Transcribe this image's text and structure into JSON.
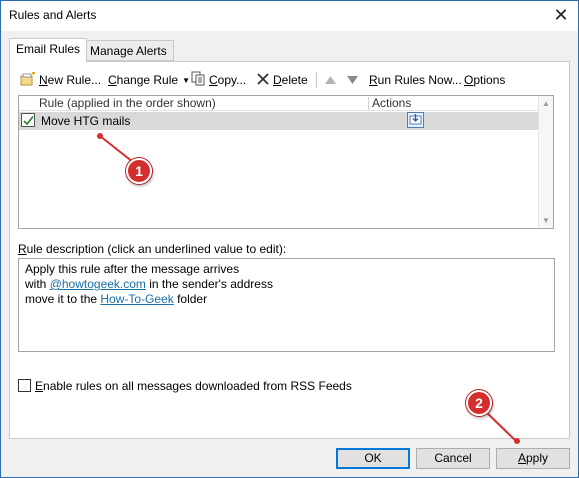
{
  "window": {
    "title": "Rules and Alerts",
    "close_glyph": "✕"
  },
  "tabs": [
    {
      "label": "Email Rules",
      "active": true
    },
    {
      "label": "Manage Alerts",
      "active": false
    }
  ],
  "toolbar": {
    "new_rule": {
      "prefix": "N",
      "rest": "ew Rule..."
    },
    "change_rule": {
      "prefix": "",
      "u": "C",
      "rest": "hange Rule"
    },
    "copy": {
      "u": "C",
      "rest": "opy..."
    },
    "delete": {
      "u": "D",
      "rest": "elete"
    },
    "run_rules": {
      "u": "R",
      "rest": "un Rules Now..."
    },
    "options": {
      "u": "O",
      "rest": "ptions"
    },
    "icons": {
      "new": "new-rule-icon",
      "copy": "copy-icon",
      "delete": "delete-icon",
      "up": "move-up-icon",
      "down": "move-down-icon"
    }
  },
  "rules_list": {
    "header_rule": "Rule (applied in the order shown)",
    "header_actions": "Actions",
    "rows": [
      {
        "name": "Move HTG mails",
        "enabled": true,
        "action_icon": "move-to-folder-icon"
      }
    ]
  },
  "description": {
    "label_u": "R",
    "label_rest": "ule description (click an underlined value to edit):",
    "line1": "Apply this rule after the message arrives",
    "line2_pre": "with ",
    "line2_link": "@howtogeek.com",
    "line2_post": " in the sender's address",
    "line3_pre": "move it to the ",
    "line3_link": "How-To-Geek",
    "line3_post": " folder"
  },
  "rss": {
    "label_u": "E",
    "label_rest": "nable rules on all messages downloaded from RSS Feeds",
    "checked": false
  },
  "buttons": {
    "ok": "OK",
    "cancel": "Cancel",
    "apply_u": "A",
    "apply_rest": "pply"
  },
  "callouts": {
    "one": "1",
    "two": "2"
  },
  "colors": {
    "accent": "#0078d7",
    "link": "#1a6fa9",
    "callout": "#d42e2e",
    "selected_row": "#d9d9d9"
  }
}
